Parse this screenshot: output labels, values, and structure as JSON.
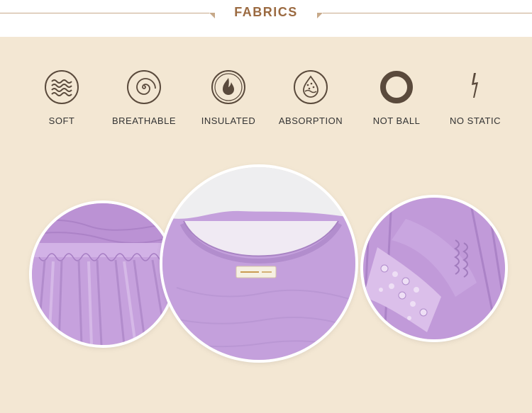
{
  "header": {
    "title": "FABRICS"
  },
  "features": [
    {
      "label": "SOFT",
      "icon": "waves-icon"
    },
    {
      "label": "BREATHABLE",
      "icon": "spiral-icon"
    },
    {
      "label": "INSULATED",
      "icon": "flame-icon"
    },
    {
      "label": "ABSORPTION",
      "icon": "droplet-icon"
    },
    {
      "label": "NOT BALL",
      "icon": "ring-icon"
    },
    {
      "label": "NO STATIC",
      "icon": "lightning-icon"
    }
  ],
  "photos": [
    {
      "subject": "gathered-fabric-detail"
    },
    {
      "subject": "neckline-with-tag"
    },
    {
      "subject": "lace-cuff-detail"
    }
  ],
  "colors": {
    "background": "#f3e7d3",
    "accent": "#9b6a41",
    "fabric": "#c4a0dc",
    "icon": "#5a4a3c"
  }
}
